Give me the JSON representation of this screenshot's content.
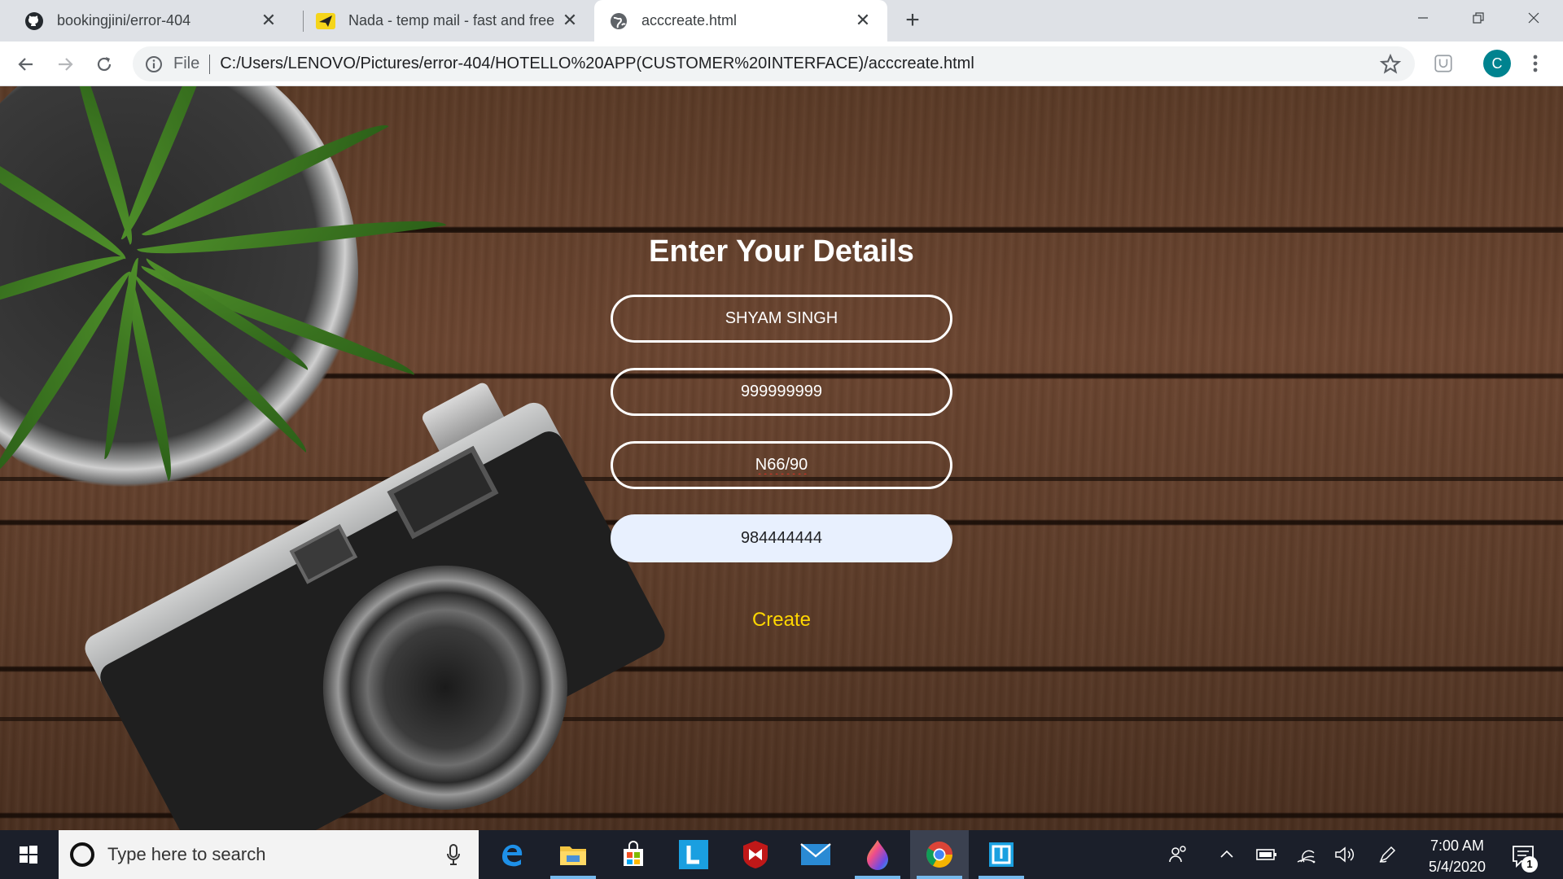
{
  "browser": {
    "tabs": [
      {
        "title": "bookingjini/error-404",
        "icon": "github-icon"
      },
      {
        "title": "Nada - temp mail - fast and free",
        "icon": "paper-plane-icon"
      },
      {
        "title": "acccreate.html",
        "icon": "globe-icon"
      }
    ],
    "address": {
      "scheme_label": "File",
      "url": "C:/Users/LENOVO/Pictures/error-404/HOTELLO%20APP(CUSTOMER%20INTERFACE)/acccreate.html"
    },
    "profile_initial": "C"
  },
  "page": {
    "title": "Enter Your Details",
    "fields": {
      "name": "SHYAM SINGH",
      "phone": "999999999",
      "address": "N66/90",
      "mobile": "984444444"
    },
    "create_label": "Create"
  },
  "taskbar": {
    "search_placeholder": "Type here to search",
    "apps": [
      "edge-icon",
      "file-explorer-icon",
      "store-icon",
      "l-app-icon",
      "mcafee-icon",
      "mail-icon",
      "paint-drop-icon",
      "chrome-icon",
      "snip-icon"
    ],
    "time": "7:00 AM",
    "date": "5/4/2020",
    "notification_count": "1"
  },
  "colors": {
    "accent_create": "#ffd700",
    "tab_strip": "#dee1e6",
    "taskbar": "#1b1f2a",
    "profile": "#00838f"
  }
}
